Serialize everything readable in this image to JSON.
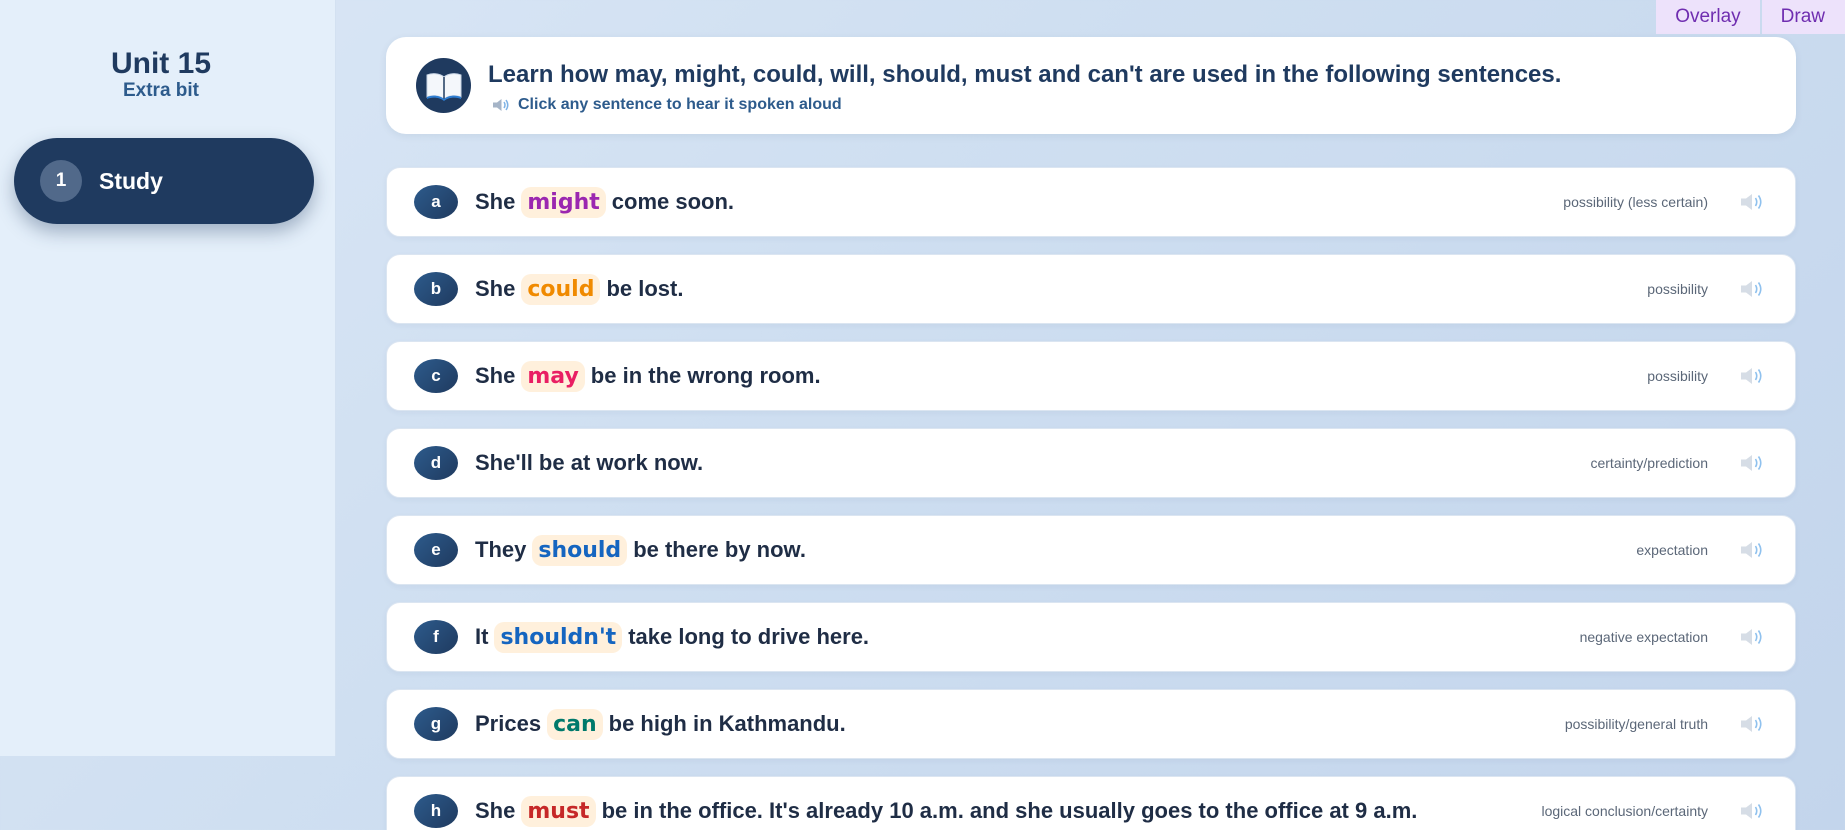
{
  "sidebar": {
    "unit_title": "Unit 15",
    "unit_subtitle": "Extra bit",
    "nav": [
      {
        "number": "1",
        "label": "Study"
      }
    ]
  },
  "toolbar": {
    "overlay_label": "Overlay",
    "draw_label": "Draw"
  },
  "header": {
    "title": "Learn how may, might, could, will, should, must and can't are used in the following sentences.",
    "hint": "Click any sentence to hear it spoken aloud"
  },
  "sentences": [
    {
      "letter": "a",
      "before": "She",
      "modal": "might",
      "after": "come soon.",
      "meaning": "possibility (less certain)",
      "modal_color": "#9b27b0"
    },
    {
      "letter": "b",
      "before": "She",
      "modal": "could",
      "after": "be lost.",
      "meaning": "possibility",
      "modal_color": "#f08a00"
    },
    {
      "letter": "c",
      "before": "She",
      "modal": "may",
      "after": "be in the wrong room.",
      "meaning": "possibility",
      "modal_color": "#e91e63"
    },
    {
      "letter": "d",
      "before": "She'll be at work now.",
      "modal": "",
      "after": "",
      "meaning": "certainty/prediction",
      "modal_color": "#1f2d45"
    },
    {
      "letter": "e",
      "before": "They",
      "modal": "should",
      "after": "be there by now.",
      "meaning": "expectation",
      "modal_color": "#1565c0"
    },
    {
      "letter": "f",
      "before": "It",
      "modal": "shouldn't",
      "after": "take long to drive here.",
      "meaning": "negative expectation",
      "modal_color": "#1565c0"
    },
    {
      "letter": "g",
      "before": "Prices",
      "modal": "can",
      "after": "be high in Kathmandu.",
      "meaning": "possibility/general truth",
      "modal_color": "#00796b"
    },
    {
      "letter": "h",
      "before": "She",
      "modal": "must",
      "after": "be in the office. It's already 10 a.m. and she usually goes to the office at 9 a.m.",
      "meaning": "logical conclusion/certainty",
      "modal_color": "#c62828"
    }
  ],
  "icons": {
    "header": "open-book-icon",
    "hint": "speaker-icon",
    "row": "speaker-icon"
  }
}
